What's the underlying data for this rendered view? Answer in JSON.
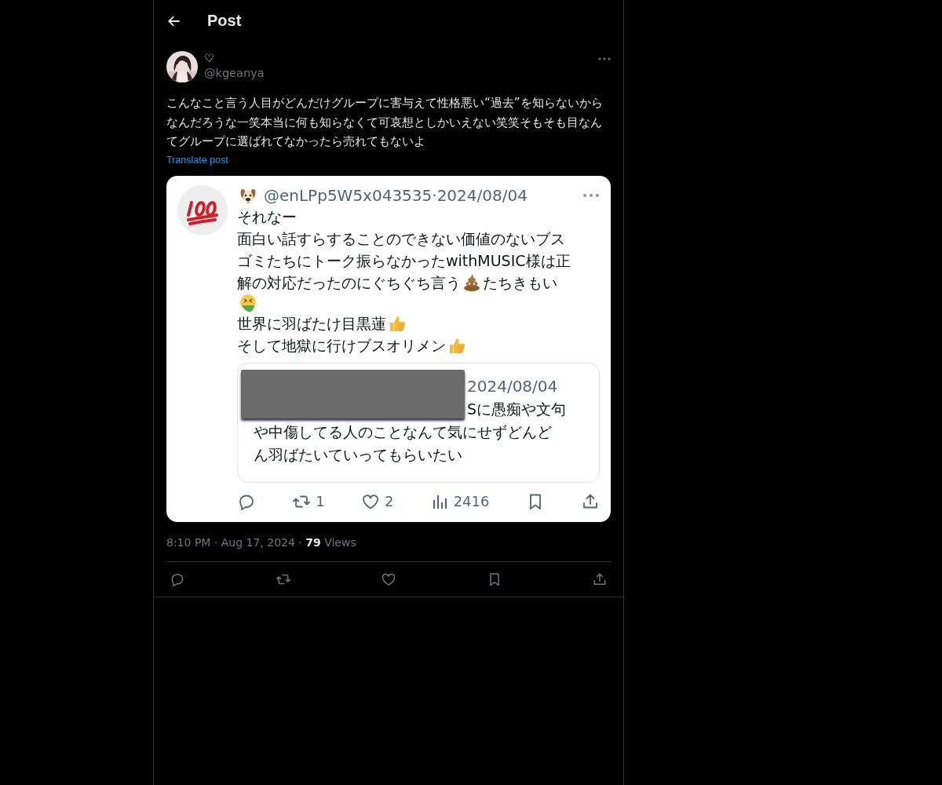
{
  "header": {
    "title": "Post"
  },
  "post": {
    "author_name": "♡",
    "handle": "@kgeanya",
    "text": "こんなこと言う人目がどんだけグループに害与えて性格悪い“過去”を知らないからなんだろうな一笑本当に何も知らなくて可哀想としかいえない笑笑そもそも目なんてグループに選ばれてなかったら売れてもないよ",
    "translate": "Translate post",
    "image": {
      "header": "@enLPp5W5x043535·2024/08/04",
      "lines": [
        {
          "parts": [
            {
              "kind": "text",
              "text": "それなー"
            }
          ]
        },
        {
          "parts": [
            {
              "kind": "text",
              "text": "面白い話すらすることのできない価値のないブス"
            }
          ]
        },
        {
          "parts": [
            {
              "kind": "text",
              "text": "ゴミたちにトーク振らなかったwithMUSIC様は正"
            }
          ]
        },
        {
          "parts": [
            {
              "kind": "text",
              "text": "解の対応だったのにぐちぐち言う"
            },
            {
              "kind": "poop"
            },
            {
              "kind": "text",
              "text": "たちきもい"
            }
          ]
        },
        {
          "parts": [
            {
              "kind": "sick"
            }
          ]
        },
        {
          "parts": [
            {
              "kind": "text",
              "text": "世界に羽ばたけ目黒蓮"
            },
            {
              "kind": "thumb"
            }
          ]
        },
        {
          "parts": [
            {
              "kind": "text",
              "text": "そして地獄に行けブスオリメン"
            },
            {
              "kind": "thumb"
            }
          ]
        }
      ],
      "quote": {
        "date": "2024/08/04",
        "lines": [
          "Sに愚痴や文句",
          "や中傷してる人のことなんて気にせずどんど",
          "ん羽ばたいていってもらいたい"
        ]
      },
      "actions": [
        {
          "kind": "reply"
        },
        {
          "kind": "retweet",
          "count": "1"
        },
        {
          "kind": "like",
          "count": "2"
        },
        {
          "kind": "views",
          "count": "2416"
        },
        {
          "kind": "bookmark"
        },
        {
          "kind": "share"
        }
      ]
    },
    "meta": "8:10 PM · Aug 17, 2024 · **79** Views",
    "actions": [
      {
        "kind": "reply"
      },
      {
        "kind": "retweet"
      },
      {
        "kind": "like"
      },
      {
        "kind": "bookmark"
      },
      {
        "kind": "share"
      }
    ]
  }
}
